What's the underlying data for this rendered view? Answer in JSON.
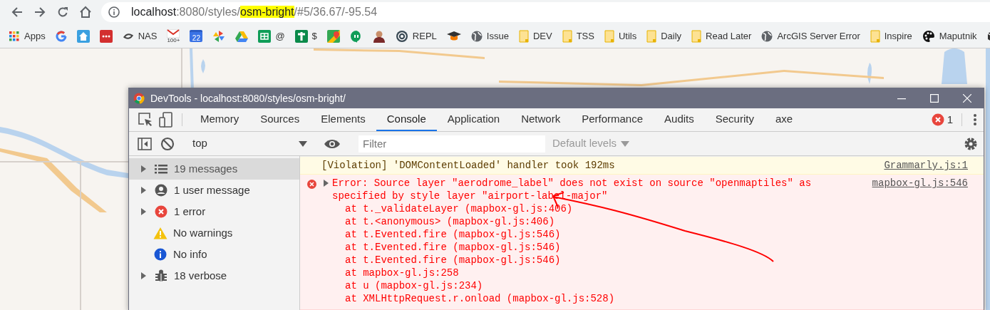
{
  "browser": {
    "url": {
      "host": "localhost",
      "before": ":8080/styles/",
      "highlight": "osm-bright",
      "after": "/#5/36.67/-95.54"
    },
    "bookmarks": [
      {
        "kind": "apps",
        "label": "Apps"
      },
      {
        "kind": "ring"
      },
      {
        "kind": "house"
      },
      {
        "kind": "dots"
      },
      {
        "kind": "swirl",
        "label": "NAS"
      },
      {
        "kind": "mail",
        "icon_text": "100+"
      },
      {
        "kind": "calendar",
        "icon_text": "22"
      },
      {
        "kind": "pinwheel"
      },
      {
        "kind": "triangle"
      },
      {
        "kind": "sheet",
        "label": "@"
      },
      {
        "kind": "plus",
        "label": "$"
      },
      {
        "kind": "pin"
      },
      {
        "kind": "chat"
      },
      {
        "kind": "person"
      },
      {
        "kind": "spiral",
        "label": "REPL"
      },
      {
        "kind": "cap"
      },
      {
        "kind": "globe",
        "label": "Issue"
      },
      {
        "kind": "folder",
        "label": "DEV"
      },
      {
        "kind": "folder",
        "label": "TSS"
      },
      {
        "kind": "folder",
        "label": "Utils"
      },
      {
        "kind": "folder",
        "label": "Daily"
      },
      {
        "kind": "folder",
        "label": "Read Later"
      },
      {
        "kind": "globe",
        "label": "ArcGIS Server Error"
      },
      {
        "kind": "folder",
        "label": "Inspire"
      },
      {
        "kind": "palette",
        "label": "Maputnik"
      },
      {
        "kind": "cube"
      }
    ]
  },
  "devtools": {
    "title": "DevTools - localhost:8080/styles/osm-bright/",
    "tabs": [
      {
        "label": "Memory",
        "selected": false
      },
      {
        "label": "Sources",
        "selected": false
      },
      {
        "label": "Elements",
        "selected": false
      },
      {
        "label": "Console",
        "selected": true
      },
      {
        "label": "Application",
        "selected": false
      },
      {
        "label": "Network",
        "selected": false
      },
      {
        "label": "Performance",
        "selected": false
      },
      {
        "label": "Audits",
        "selected": false
      },
      {
        "label": "Security",
        "selected": false
      },
      {
        "label": "axe",
        "selected": false
      }
    ],
    "error_count": "1",
    "context": "top",
    "filter": {
      "placeholder": "Filter"
    },
    "levels": "Default levels",
    "sidebar": [
      {
        "kind": "list",
        "label": "19 messages",
        "selected": true,
        "expandable": true
      },
      {
        "kind": "user",
        "label": "1 user message",
        "selected": false,
        "expandable": true
      },
      {
        "kind": "error",
        "label": "1 error",
        "selected": false,
        "expandable": true
      },
      {
        "kind": "warning",
        "label": "No warnings",
        "selected": false,
        "expandable": false
      },
      {
        "kind": "info",
        "label": "No info",
        "selected": false,
        "expandable": false
      },
      {
        "kind": "bug",
        "label": "18 verbose",
        "selected": false,
        "expandable": true
      }
    ],
    "messages": [
      {
        "kind": "violation",
        "text": "[Violation] 'DOMContentLoaded' handler took 192ms",
        "source": "Grammarly.js:1"
      },
      {
        "kind": "error",
        "expanded": false,
        "text": "Error: Source layer \"aerodrome_label\" does not exist on source \"openmaptiles\" as specified by style layer \"airport-label-major\"",
        "source": "mapbox-gl.js:546",
        "stack": [
          {
            "prefix": "at t._validateLayer (",
            "link": "mapbox-gl.js:406",
            "suffix": ")"
          },
          {
            "prefix": "at t.<anonymous> (",
            "link": "mapbox-gl.js:406",
            "suffix": ")"
          },
          {
            "prefix": "at t.Evented.fire (",
            "link": "mapbox-gl.js:546",
            "suffix": ")"
          },
          {
            "prefix": "at t.Evented.fire (",
            "link": "mapbox-gl.js:546",
            "suffix": ")"
          },
          {
            "prefix": "at t.Evented.fire (",
            "link": "mapbox-gl.js:546",
            "suffix": ")"
          },
          {
            "prefix": "at ",
            "link": "mapbox-gl.js:258"
          },
          {
            "prefix": "at u (",
            "link": "mapbox-gl.js:234",
            "suffix": ")"
          },
          {
            "prefix": "at XMLHttpRequest.r.onload (",
            "link": "mapbox-gl.js:528",
            "suffix": ")"
          }
        ]
      }
    ]
  }
}
